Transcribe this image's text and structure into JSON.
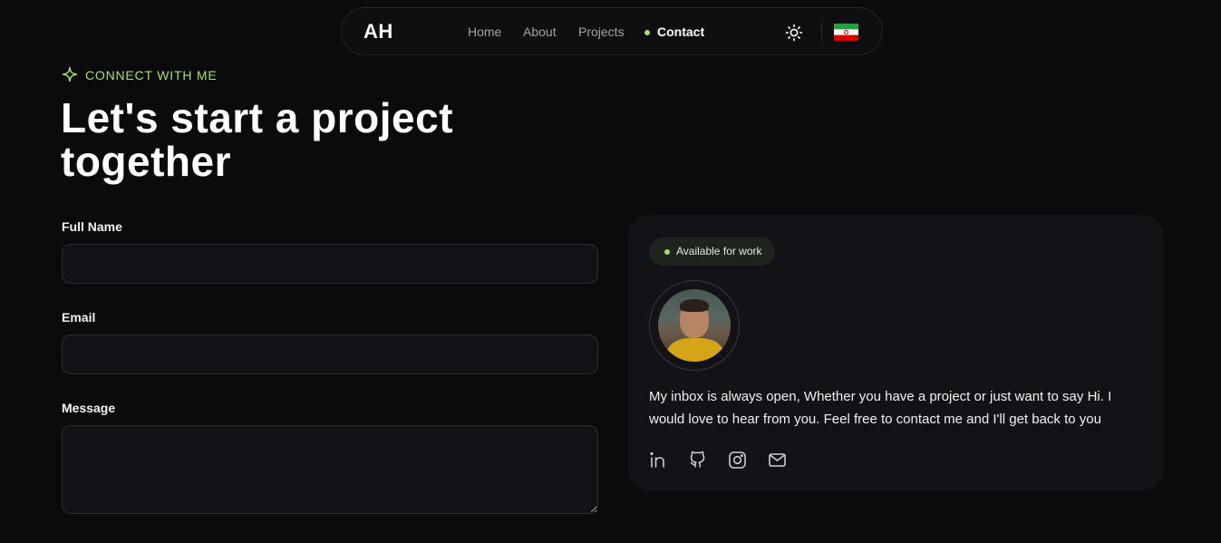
{
  "nav": {
    "logo": "AH",
    "links": [
      {
        "label": "Home"
      },
      {
        "label": "About"
      },
      {
        "label": "Projects"
      },
      {
        "label": "Contact",
        "active": true
      }
    ],
    "theme_icon": "sun-icon",
    "language_icon": "iran-flag-icon"
  },
  "header": {
    "eyebrow": "CONNECT WITH ME",
    "eyebrow_icon": "sparkle-icon",
    "title": "Let's start a project together"
  },
  "form": {
    "full_name": {
      "label": "Full Name",
      "value": "",
      "placeholder": ""
    },
    "email": {
      "label": "Email",
      "value": "",
      "placeholder": ""
    },
    "message": {
      "label": "Message",
      "value": "",
      "placeholder": ""
    }
  },
  "card": {
    "badge": "Available for work",
    "bio": "My inbox is always open, Whether you have a project or just want to say Hi. I would love to hear from you. Feel free to contact me and I'll get back to you",
    "socials": [
      "linkedin-icon",
      "github-icon",
      "instagram-icon",
      "mail-icon"
    ]
  },
  "colors": {
    "background": "#0b0b0d",
    "accent": "#a3e16a",
    "card": "#131317",
    "input_border": "#2c2c31"
  }
}
